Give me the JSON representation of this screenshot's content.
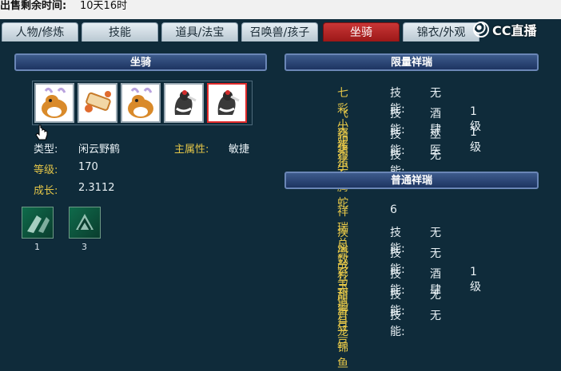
{
  "top": {
    "label": "出售剩余时间:",
    "value": "10天16时"
  },
  "tabs": [
    {
      "label": "人物/修炼",
      "active": false
    },
    {
      "label": "技能",
      "active": false
    },
    {
      "label": "道具/法宝",
      "active": false
    },
    {
      "label": "召唤兽/孩子",
      "active": false
    },
    {
      "label": "坐骑",
      "active": true
    },
    {
      "label": "锦衣/外观",
      "active": false
    }
  ],
  "logo": {
    "text": "CC直播"
  },
  "mount": {
    "section_title": "坐骑",
    "slots": [
      {
        "icon": "deer-mount-icon"
      },
      {
        "icon": "scroll-item-icon"
      },
      {
        "icon": "deer-mount-icon"
      },
      {
        "icon": "crane-mount-icon"
      },
      {
        "icon": "crane-mount-icon",
        "selected": true
      }
    ],
    "type_label": "类型:",
    "type_value": "闲云野鹤",
    "main_attr_label": "主属性:",
    "main_attr_value": "敏捷",
    "level_label": "等级:",
    "level_value": "170",
    "growth_label": "成长:",
    "growth_value": "2.3112",
    "skills": [
      {
        "icon": "claw-skill-icon",
        "count": "1"
      },
      {
        "icon": "crest-skill-icon",
        "count": "3"
      }
    ]
  },
  "limited": {
    "title": "限量祥瑞",
    "rows": [
      {
        "name": "七彩小驴",
        "skill_label": "技能:",
        "skill": "无",
        "level": ""
      },
      {
        "name": "飞天猪猪",
        "skill_label": "技能:",
        "skill": "酒肆",
        "level": "1级"
      },
      {
        "name": "猪猪小侠",
        "skill_label": "技能:",
        "skill": "巫医",
        "level": "1级"
      },
      {
        "name": "香云腾蛇",
        "skill_label": "技能:",
        "skill": "无",
        "level": ""
      }
    ]
  },
  "normal": {
    "title": "普通祥瑞",
    "total_label": "祥瑞总数",
    "total_value": "6",
    "rows": [
      {
        "name": "疾风战马",
        "skill_label": "技能:",
        "skill": "无",
        "level": ""
      },
      {
        "name": "流云玉佩",
        "skill_label": "技能:",
        "skill": "无",
        "level": ""
      },
      {
        "name": "彩云追月",
        "skill_label": "技能:",
        "skill": "酒肆",
        "level": "1级"
      },
      {
        "name": "甜蜜豆豆",
        "skill_label": "技能:",
        "skill": "无",
        "level": ""
      },
      {
        "name": "灯笼锦鱼",
        "skill_label": "技能:",
        "skill": "无",
        "level": ""
      }
    ]
  }
}
